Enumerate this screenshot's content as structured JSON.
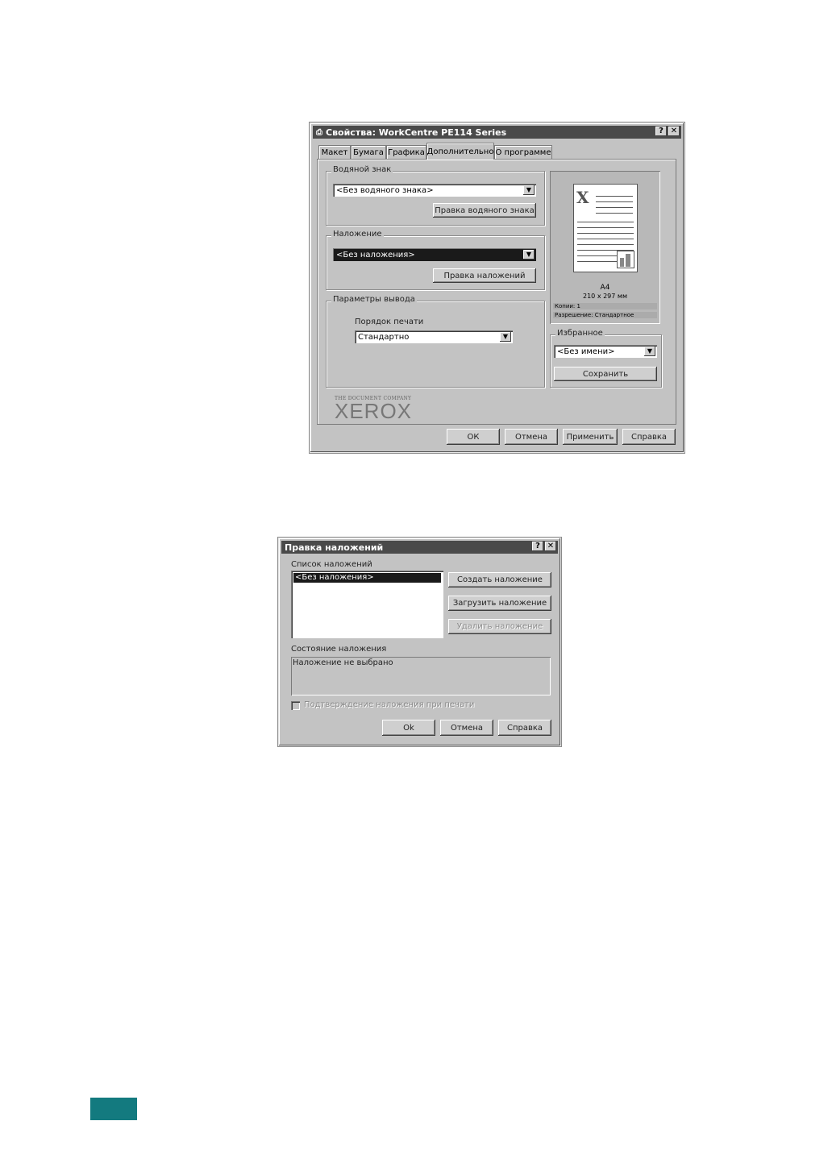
{
  "properties_dialog": {
    "title": "Свойства: WorkCentre PE114 Series",
    "help_button": "?",
    "close_button": "✕",
    "tabs": [
      "Макет",
      "Бумага",
      "Графика",
      "Дополнительно",
      "О программе"
    ],
    "watermark_group": {
      "label": "Водяной знак",
      "select_value": "<Без водяного знака>",
      "edit_button": "Правка водяного знака"
    },
    "overlay_group": {
      "label": "Наложение",
      "select_value": "<Без наложения>",
      "edit_button": "Правка наложений"
    },
    "output_group": {
      "label": "Параметры вывода",
      "print_order_label": "Порядок печати",
      "print_order_value": "Стандартно"
    },
    "preview": {
      "paper_size": "A4",
      "dimensions": "210 x 297 мм",
      "copies": "Копии: 1",
      "resolution": "Разрешение: Стандартное"
    },
    "favorites_group": {
      "label": "Избранное",
      "select_value": "<Без имени>",
      "save_button": "Сохранить"
    },
    "logo": {
      "tagline": "THE DOCUMENT COMPANY",
      "brand": "XEROX"
    },
    "footer_buttons": {
      "ok": "ОК",
      "cancel": "Отмена",
      "apply": "Применить",
      "help": "Справка"
    }
  },
  "overlay_dialog": {
    "title": "Правка наложений",
    "help_button": "?",
    "close_button": "✕",
    "list_label": "Список наложений",
    "list_items": [
      "<Без наложения>"
    ],
    "create_button": "Создать наложение",
    "load_button": "Загрузить наложение",
    "delete_button": "Удалить наложение",
    "status_label": "Состояние наложения",
    "status_text": "Наложение не выбрано",
    "confirm_checkbox_label": "Подтверждение наложения при печати",
    "ok_button": "Ok",
    "cancel_button": "Отмена",
    "help_footer_button": "Справка"
  }
}
